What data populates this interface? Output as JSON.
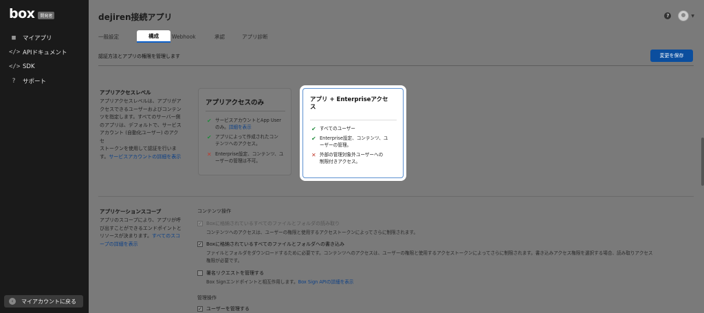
{
  "sidebar": {
    "logo": "box",
    "badge": "開発者",
    "items": [
      {
        "icon": "grid-icon",
        "glyph": "▦",
        "label": "マイアプリ"
      },
      {
        "icon": "code-icon",
        "glyph": "</>",
        "label": "APIドキュメント"
      },
      {
        "icon": "code-icon",
        "glyph": "</>",
        "label": "SDK"
      },
      {
        "icon": "help-circle-icon",
        "glyph": "?",
        "label": "サポート"
      }
    ],
    "back_label": "マイアカウントに戻る"
  },
  "header": {
    "title": "dejiren接続アプリ",
    "tabs": [
      "一般設定",
      "構成",
      "Webhook",
      "承認",
      "アプリ診断"
    ],
    "active_tab": 1,
    "subtitle": "認証方法とアプリの権限を管理します",
    "save_label": "変更を保存"
  },
  "access": {
    "title": "アプリアクセスレベル",
    "desc_lines": [
      "アプリアクセスレベルは、アプリがア",
      "クセスできるユーザーおよびコンテン",
      "ツを指定します。すべてのサーバー側",
      "のアプリは、デフォルトで、サービス",
      "アカウント (自動化ユーザー) のアクセ",
      "ストークンを使用して認証を行いま",
      "す。"
    ],
    "desc_link": "サービスアカウントの詳細を表示",
    "card1": {
      "title": "アプリアクセスのみ",
      "features": [
        {
          "type": "check",
          "lines": [
            "サービスアカウントとApp User",
            "のみ。"
          ],
          "link": "詳細を表示"
        },
        {
          "type": "check",
          "lines": [
            "アプリによって作成されたコン",
            "テンツへのアクセス。"
          ]
        },
        {
          "type": "cross",
          "lines": [
            "Enterprise設定、コンテンツ、ユ",
            "ーザーの管理は不可。"
          ]
        }
      ]
    },
    "card2": {
      "title_line1": "アプリ + Enterpriseアクセ",
      "title_line2": "ス",
      "features": [
        {
          "type": "check",
          "lines": [
            "すべてのユーザー"
          ]
        },
        {
          "type": "check",
          "lines": [
            "Enterprise設定、コンテンツ、ユ",
            "ーザーの管理。"
          ]
        },
        {
          "type": "cross",
          "lines": [
            "外部の管理対象外ユーザーへの",
            "制限付きアクセス。"
          ]
        }
      ]
    }
  },
  "scopes": {
    "title": "アプリケーションスコープ",
    "desc_lines": [
      "アプリのスコープにより、アプリが呼",
      "び出すことができるエンドポイントと",
      "リソースが決まります。"
    ],
    "desc_link_a": "すべてのスコ",
    "desc_link_b": "ープの詳細を表示",
    "content_group": "コンテンツ操作",
    "options": [
      {
        "label": "Boxに格納されているすべてのファイルとフォルダの読み取り",
        "checked": true,
        "disabled": true,
        "desc": "コンテンツへのアクセスは、ユーザーの権限と使用するアクセストークンによってさらに制限されます。"
      },
      {
        "label": "Boxに格納されているすべてのファイルとフォルダへの書き込み",
        "checked": true,
        "disabled": false,
        "desc1": "ファイルとフォルダをダウンロードするために必要です。コンテンツへのアクセスは、ユーザーの権限と使用するアクセストークンによってさらに制限されます。書き込みアクセス権限を選択する場合、読み取りアクセス",
        "desc2": "権限が必要です。"
      },
      {
        "label": "署名リクエストを管理する",
        "checked": false,
        "disabled": false,
        "desc": "Box Signエンドポイントと相互作用します。",
        "link": "Box Sign APIの詳細を表示"
      }
    ],
    "admin_group": "管理操作",
    "admin_option": "ユーザーを管理する"
  }
}
